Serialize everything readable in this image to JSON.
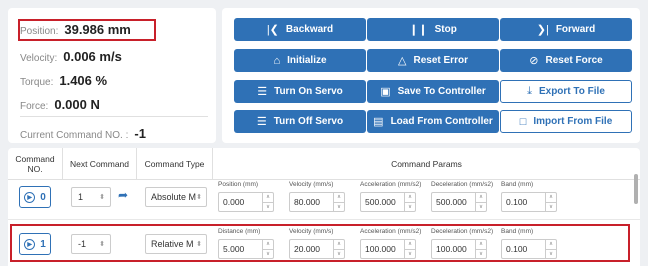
{
  "status": {
    "position": {
      "label": "Position:",
      "value": "39.986 mm"
    },
    "velocity": {
      "label": "Velocity:",
      "value": "0.006 m/s"
    },
    "torque": {
      "label": "Torque:",
      "value": "1.406 %"
    },
    "force": {
      "label": "Force:",
      "value": "0.000 N"
    },
    "current_command": {
      "label": "Current Command NO. :",
      "value": "-1"
    }
  },
  "buttons": {
    "backward": "Backward",
    "stop": "Stop",
    "forward": "Forward",
    "initialize": "Initialize",
    "reset_error": "Reset Error",
    "reset_force": "Reset Force",
    "turn_on_servo": "Turn On Servo",
    "save_to_controller": "Save To Controller",
    "export_to_file": "Export To File",
    "turn_off_servo": "Turn Off Servo",
    "load_from_controller": "Load From Controller",
    "import_from_file": "Import From File"
  },
  "table": {
    "headers": {
      "command_no": "Command NO.",
      "next_command": "Next Command",
      "command_type": "Command Type",
      "command_params": "Command Params"
    },
    "rows": [
      {
        "no": "0",
        "next": "1",
        "type": "Absolute M",
        "params": [
          {
            "label": "Position (mm)",
            "value": "0.000"
          },
          {
            "label": "Velocity (mm/s)",
            "value": "80.000"
          },
          {
            "label": "Acceleration (mm/s2)",
            "value": "500.000"
          },
          {
            "label": "Deceleration (mm/s2)",
            "value": "500.000"
          },
          {
            "label": "Band (mm)",
            "value": "0.100"
          }
        ]
      },
      {
        "no": "1",
        "next": "-1",
        "type": "Relative M",
        "params": [
          {
            "label": "Distance (mm)",
            "value": "5.000"
          },
          {
            "label": "Velocity (mm/s)",
            "value": "20.000"
          },
          {
            "label": "Acceleration (mm/s2)",
            "value": "100.000"
          },
          {
            "label": "Deceleration (mm/s2)",
            "value": "100.000"
          },
          {
            "label": "Band (mm)",
            "value": "0.100"
          }
        ]
      }
    ]
  },
  "colors": {
    "accent": "#2f71b6",
    "highlight": "#c8202a"
  }
}
